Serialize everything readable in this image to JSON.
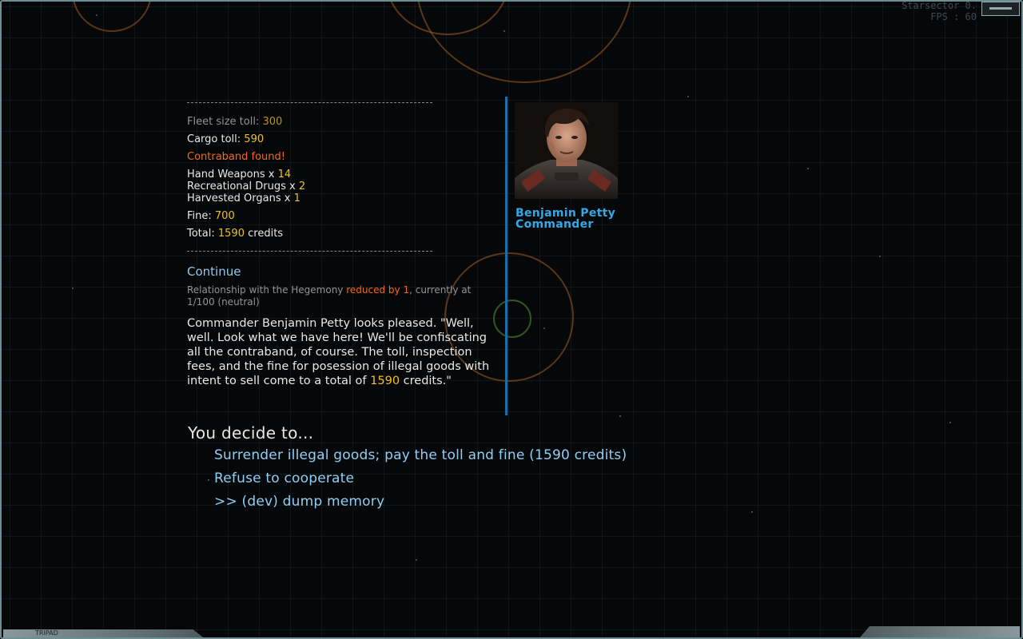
{
  "hud": {
    "game_title": "Starsector 0.",
    "fps_label": "FPS : 60"
  },
  "bottom_bar": {
    "label": "TRIPAD"
  },
  "report": {
    "fleet_toll_label": "Fleet size toll:",
    "fleet_toll_value": "300",
    "cargo_toll_label": "Cargo toll:",
    "cargo_toll_value": "590",
    "contraband_header": "Contraband found!",
    "contraband_items": [
      {
        "label": "Hand Weapons x",
        "count": "14"
      },
      {
        "label": "Recreational Drugs x",
        "count": "2"
      },
      {
        "label": "Harvested Organs x",
        "count": "1"
      }
    ],
    "fine_label": "Fine:",
    "fine_value": "700",
    "total_label": "Total:",
    "total_value": "1590",
    "total_unit": "credits"
  },
  "continue_label": "Continue",
  "relationship": {
    "prefix": "Relationship with the Hegemony",
    "change": "reduced by 1",
    "suffix": ", currently at",
    "current": "1/100 (neutral)"
  },
  "narrative": {
    "text": "Commander Benjamin Petty looks pleased. \"Well, well. Look what we have here! We'll be confiscating all the contraband, of course. The toll, inspection fees, and the fine for posession of illegal goods with intent to sell come to a total of",
    "amount": "1590",
    "ending": "credits.\""
  },
  "contact": {
    "name": "Benjamin Petty",
    "rank": "Commander",
    "portrait_icon": "commander-portrait"
  },
  "decision": {
    "header": "You decide to...",
    "options": [
      "Surrender illegal goods; pay the toll and fine (1590 credits)",
      "Refuse to cooperate",
      ">> (dev) dump memory"
    ]
  },
  "colors": {
    "highlight_gold": "#f0c020",
    "warning_orange": "#f26a1b",
    "option_cyan": "#8fd0f5",
    "name_blue": "#34a8e8",
    "divider_blue": "#1b6fa8"
  }
}
